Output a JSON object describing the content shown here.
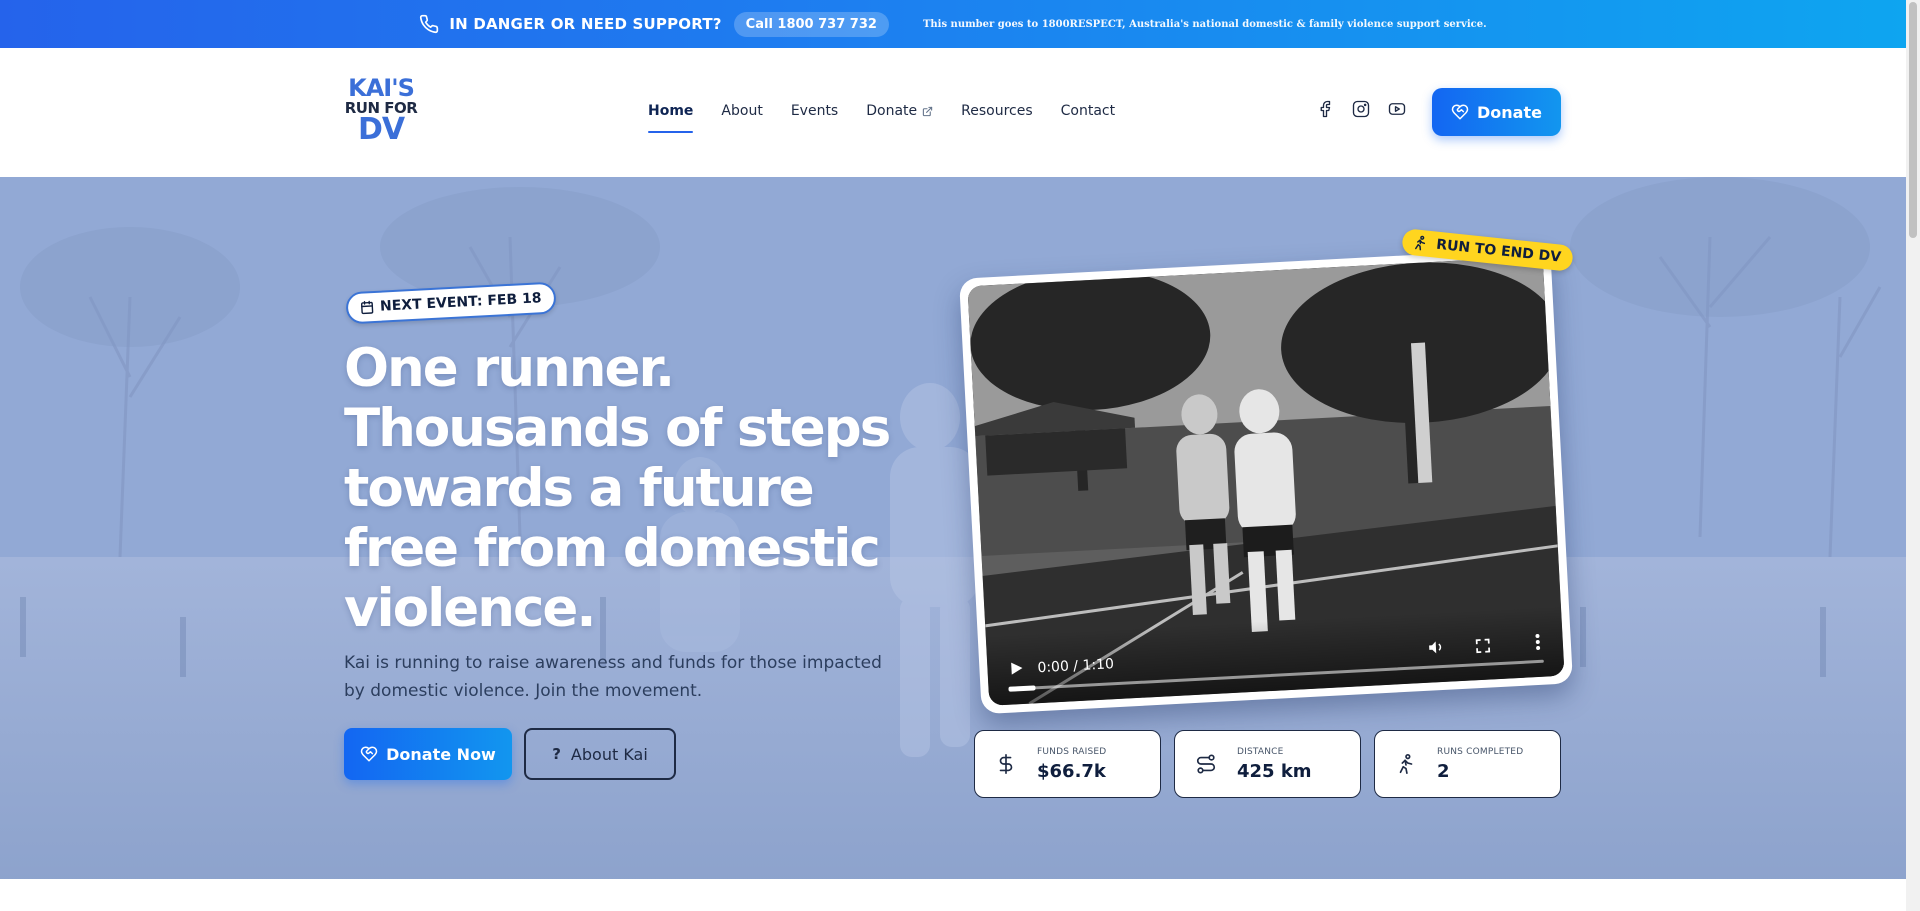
{
  "topbar": {
    "danger_text": "IN DANGER OR NEED SUPPORT?",
    "call_label": "Call 1800 737 732",
    "note": "This number goes to 1800RESPECT, Australia's national domestic & family violence support service.",
    "phone_icon": "phone-icon"
  },
  "logo": {
    "line1": "KAI'S",
    "line2": "RUN FOR",
    "line3": "DV"
  },
  "nav": {
    "items": [
      {
        "label": "Home",
        "active": true
      },
      {
        "label": "About"
      },
      {
        "label": "Events"
      },
      {
        "label": "Donate",
        "external": true
      },
      {
        "label": "Resources"
      },
      {
        "label": "Contact"
      }
    ]
  },
  "socials": [
    "facebook-icon",
    "instagram-icon",
    "youtube-icon"
  ],
  "header_donate": {
    "label": "Donate",
    "icon": "heart-hand-icon"
  },
  "hero": {
    "next_event": "NEXT EVENT: FEB 18",
    "headline": "One runner. Thousands of steps towards a future free from domestic violence.",
    "subtext": "Kai is running to raise awareness and funds for those impacted by domestic violence. Join the movement.",
    "donate_now": "Donate Now",
    "about_kai": "About Kai",
    "run_badge": "RUN TO END DV"
  },
  "video": {
    "time": "0:00 / 1:10",
    "progress": 0.05
  },
  "stats": [
    {
      "label": "FUNDS RAISED",
      "value": "$66.7k",
      "icon": "dollar-icon"
    },
    {
      "label": "DISTANCE",
      "value": "425 km",
      "icon": "route-icon"
    },
    {
      "label": "RUNS COMPLETED",
      "value": "2",
      "icon": "runner-icon"
    }
  ],
  "colors": {
    "accent": "#1366f2",
    "accent_light": "#1296ef",
    "badge_yellow": "#ffd51f",
    "hero_bg": "#8ea7d4",
    "text_dark": "#0f1e3d"
  }
}
